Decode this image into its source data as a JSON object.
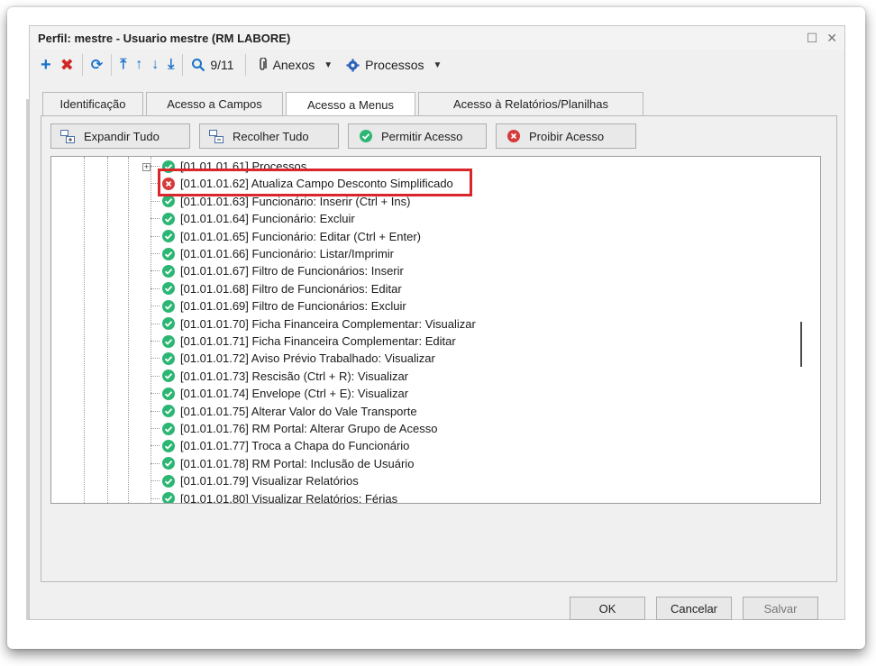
{
  "window": {
    "title": "Perfil: mestre - Usuario mestre (RM LABORE)"
  },
  "toolbar": {
    "record_counter": "9/11",
    "annexes_label": "Anexos",
    "processes_label": "Processos"
  },
  "tabs": [
    {
      "label": "Identificação",
      "active": false
    },
    {
      "label": "Acesso a Campos",
      "active": false
    },
    {
      "label": "Acesso a Menus",
      "active": true
    },
    {
      "label": "Acesso à Relatórios/Planilhas",
      "active": false
    }
  ],
  "actions": {
    "expand_all": "Expandir Tudo",
    "collapse_all": "Recolher Tudo",
    "allow_access": "Permitir Acesso",
    "deny_access": "Proibir Acesso"
  },
  "tree": {
    "items": [
      {
        "label": "[01.01.01.61] Processos",
        "status": "allowed"
      },
      {
        "label": "[01.01.01.62] Atualiza Campo Desconto Simplificado",
        "status": "denied"
      },
      {
        "label": "[01.01.01.63] Funcionário: Inserir (Ctrl + Ins)",
        "status": "allowed"
      },
      {
        "label": "[01.01.01.64] Funcionário: Excluir",
        "status": "allowed"
      },
      {
        "label": "[01.01.01.65] Funcionário: Editar (Ctrl + Enter)",
        "status": "allowed"
      },
      {
        "label": "[01.01.01.66] Funcionário: Listar/Imprimir",
        "status": "allowed"
      },
      {
        "label": "[01.01.01.67] Filtro de Funcionários: Inserir",
        "status": "allowed"
      },
      {
        "label": "[01.01.01.68] Filtro de Funcionários: Editar",
        "status": "allowed"
      },
      {
        "label": "[01.01.01.69] Filtro de Funcionários: Excluir",
        "status": "allowed"
      },
      {
        "label": "[01.01.01.70] Ficha Financeira Complementar: Visualizar",
        "status": "allowed"
      },
      {
        "label": "[01.01.01.71] Ficha Financeira Complementar: Editar",
        "status": "allowed"
      },
      {
        "label": "[01.01.01.72] Aviso Prévio Trabalhado: Visualizar",
        "status": "allowed"
      },
      {
        "label": "[01.01.01.73] Rescisão (Ctrl + R): Visualizar",
        "status": "allowed"
      },
      {
        "label": "[01.01.01.74] Envelope (Ctrl + E): Visualizar",
        "status": "allowed"
      },
      {
        "label": "[01.01.01.75] Alterar Valor do Vale Transporte",
        "status": "allowed"
      },
      {
        "label": "[01.01.01.76] RM Portal: Alterar Grupo de Acesso",
        "status": "allowed"
      },
      {
        "label": "[01.01.01.77] Troca a Chapa do Funcionário",
        "status": "allowed"
      },
      {
        "label": "[01.01.01.78] RM Portal:  Inclusão de Usuário",
        "status": "allowed"
      },
      {
        "label": "[01.01.01.79] Visualizar Relatórios",
        "status": "allowed"
      },
      {
        "label": "[01.01.01.80] Visualizar Relatórios: Férias",
        "status": "allowed"
      }
    ]
  },
  "footer": {
    "ok": "OK",
    "cancel": "Cancelar",
    "save": "Salvar"
  },
  "colors": {
    "allowed": "#2cb673",
    "denied": "#d63a3a",
    "highlight": "#d9262b",
    "toolbar_blue": "#1a73c9"
  }
}
